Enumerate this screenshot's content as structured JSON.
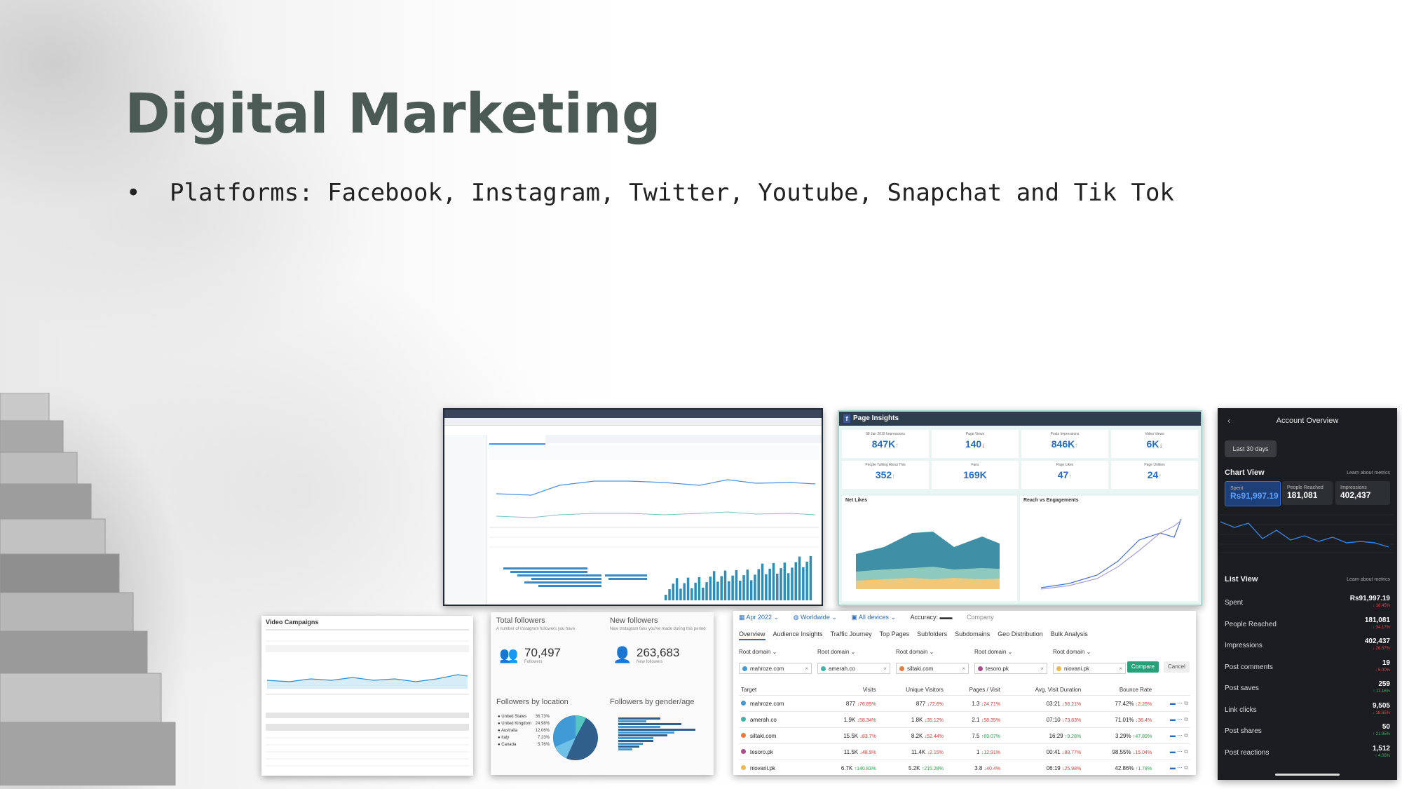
{
  "slide": {
    "title": "Digital Marketing",
    "bullet": "•",
    "bullet_text": "Platforms: Facebook, Instagram, Twitter, Youtube, Snapchat and Tik Tok"
  },
  "page_insights": {
    "header": "Page Insights",
    "metrics": [
      {
        "label": "08 Jan 2019 Impressions",
        "value": "847K",
        "dir": "up"
      },
      {
        "label": "Page Views",
        "value": "140",
        "dir": "down"
      },
      {
        "label": "Posts Impressions",
        "value": "846K",
        "dir": "up"
      },
      {
        "label": "Video Views",
        "value": "6K",
        "dir": "down"
      },
      {
        "label": "People Talking About This",
        "value": "352",
        "dir": "up"
      },
      {
        "label": "Fans",
        "value": "169K",
        "dir": ""
      },
      {
        "label": "Page Likes",
        "value": "47",
        "dir": "up"
      },
      {
        "label": "Page Unlikes",
        "value": "24",
        "dir": "up"
      }
    ],
    "panel_left_title": "Net Likes",
    "panel_right_title": "Reach vs Engagements"
  },
  "account_overview": {
    "title": "Account Overview",
    "period": "Last 30 days",
    "chart_view": "Chart View",
    "learn": "Learn about metrics",
    "kpis": [
      {
        "label": "Spent",
        "value": "Rs91,997.19"
      },
      {
        "label": "People Reached",
        "value": "181,081"
      },
      {
        "label": "Impressions",
        "value": "402,437"
      }
    ],
    "list_view": "List View",
    "rows": [
      {
        "label": "Spent",
        "value": "Rs91,997.19",
        "delta": "↓ 18.45%",
        "dir": "down"
      },
      {
        "label": "People Reached",
        "value": "181,081",
        "delta": "↓ 34.17%",
        "dir": "down"
      },
      {
        "label": "Impressions",
        "value": "402,437",
        "delta": "↓ 28.57%",
        "dir": "down"
      },
      {
        "label": "Post comments",
        "value": "19",
        "delta": "↓ 5.00%",
        "dir": "down"
      },
      {
        "label": "Post saves",
        "value": "259",
        "delta": "↑ 11.16%",
        "dir": "up"
      },
      {
        "label": "Link clicks",
        "value": "9,505",
        "delta": "↓ 18.65%",
        "dir": "down"
      },
      {
        "label": "Post shares",
        "value": "50",
        "delta": "↑ 21.95%",
        "dir": "up"
      },
      {
        "label": "Post reactions",
        "value": "1,512",
        "delta": "↑ 4.06%",
        "dir": "up"
      }
    ]
  },
  "video_campaigns": {
    "title": "Video Campaigns"
  },
  "instagram": {
    "total_followers": "Total followers",
    "total_sub": "A number of Instagram followers you have",
    "total_value": "70,497",
    "followers_label": "Followers",
    "new_followers": "New followers",
    "new_sub": "New Instagram fans you've made during this period",
    "new_value": "263,683",
    "new_label": "New followers",
    "by_location": "Followers by location",
    "by_gender": "Followers by gender/age",
    "locations": [
      "United States",
      "United Kingdom",
      "Australia",
      "Italy",
      "Canada"
    ],
    "location_pcts": [
      "36.73%",
      "24.98%",
      "12.06%",
      "7.23%",
      "5.76%"
    ]
  },
  "traffic": {
    "date": "Apr 2022",
    "region": "Worldwide",
    "devices": "All devices",
    "accuracy": "Accuracy:",
    "company": "Company",
    "tabs": [
      "Overview",
      "Audience Insights",
      "Traffic Journey",
      "Top Pages",
      "Subfolders",
      "Subdomains",
      "Geo Distribution",
      "Bulk Analysis"
    ],
    "root_label": "Root domain",
    "compare": "Compare",
    "cancel": "Cancel",
    "columns": [
      "Target",
      "Visits",
      "Unique Visitors",
      "Pages / Visit",
      "Avg. Visit Duration",
      "Bounce Rate"
    ],
    "rows": [
      {
        "domain": "mahroze.com",
        "color": "#3f9ad6",
        "visits": "877",
        "vd": "↓76.85%",
        "uv": "877",
        "uvd": "↓72.6%",
        "pv": "1.3",
        "pvd": "↓24.71%",
        "dur": "03:21",
        "durd": "↓56.21%",
        "br": "77.42%",
        "brd": "↓2.26%"
      },
      {
        "domain": "amerah.co",
        "color": "#3fb6a8",
        "visits": "1.9K",
        "vd": "↓58.34%",
        "uv": "1.8K",
        "uvd": "↓35.12%",
        "pv": "2.1",
        "pvd": "↓58.35%",
        "dur": "07:10",
        "durd": "↓73.83%",
        "br": "71.01%",
        "brd": "↓36.4%"
      },
      {
        "domain": "siltaki.com",
        "color": "#e87b3a",
        "visits": "15.5K",
        "vd": "↓83.7%",
        "uv": "8.2K",
        "uvd": "↓52.44%",
        "pv": "7.5",
        "pvd": "↑69.07%",
        "dur": "16:29",
        "durd": "↑9.28%",
        "br": "3.29%",
        "brd": "↑47.89%"
      },
      {
        "domain": "tesoro.pk",
        "color": "#b04a8c",
        "visits": "11.5K",
        "vd": "↓48.9%",
        "uv": "11.4K",
        "uvd": "↓2.15%",
        "pv": "1",
        "pvd": "↓12.91%",
        "dur": "00:41",
        "durd": "↓88.77%",
        "br": "98.55%",
        "brd": "↓15.04%"
      },
      {
        "domain": "niovani.pk",
        "color": "#f0b84a",
        "visits": "6.7K",
        "vd": "↑140.83%",
        "uv": "5.2K",
        "uvd": "↑215.28%",
        "pv": "3.8",
        "pvd": "↓40.4%",
        "dur": "06:19",
        "durd": "↓25.98%",
        "br": "42.86%",
        "brd": "↑1.78%"
      }
    ]
  },
  "colors": {
    "title": "#4c5a55",
    "fb_blue": "#3b5998",
    "accent_green": "#27a17a"
  }
}
